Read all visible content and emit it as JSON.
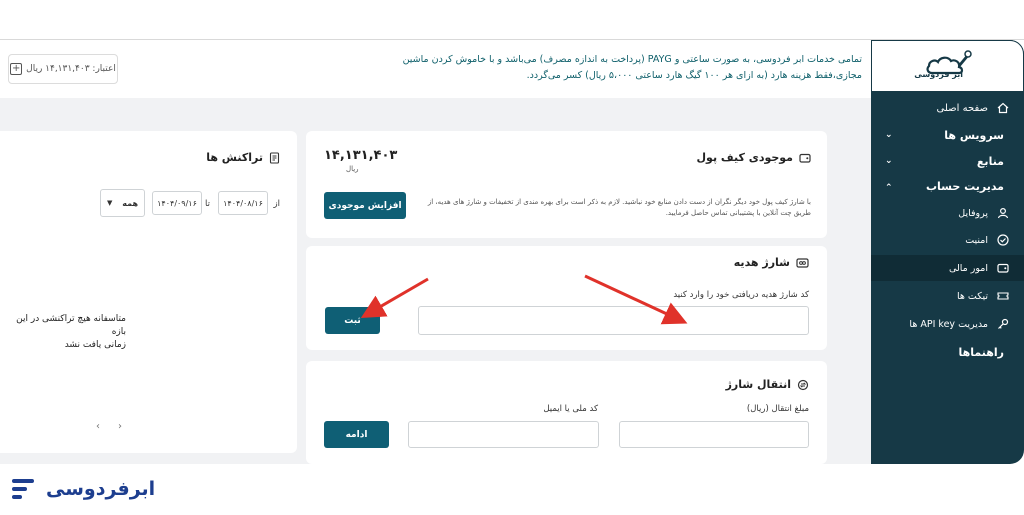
{
  "header": {
    "info_line1": "تمامی خدمات ابر فردوسی، به صورت ساعتی و PAYG (پرداخت به اندازه مصرف) می‌باشد و با خاموش کردن ماشین",
    "info_line2": "مجازی،فقط هزینه هارد (به ازای هر ۱۰۰ گیگ هارد ساعتی ۵،۰۰۰ ریال) کسر می‌گردد.",
    "balance_label": "اعتبار: ۱۴,۱۳۱,۴۰۳ ریال"
  },
  "sidebar": {
    "logo_text": "ابر فردوسی",
    "items": [
      {
        "label": "صفحه اصلی",
        "icon": "home-icon"
      },
      {
        "label": "سرویس ها",
        "icon": "chevron-down-icon"
      },
      {
        "label": "منابع",
        "icon": "chevron-down-icon"
      },
      {
        "label": "مدیریت حساب",
        "icon": "chevron-up-icon"
      },
      {
        "label": "پروفایل",
        "icon": "user-icon"
      },
      {
        "label": "امنیت",
        "icon": "shield-check-icon"
      },
      {
        "label": "امور مالی",
        "icon": "wallet-icon"
      },
      {
        "label": "تیکت ها",
        "icon": "ticket-icon"
      },
      {
        "label": "مدیریت API key ها",
        "icon": "key-icon"
      },
      {
        "label": "راهنماها",
        "icon": ""
      }
    ]
  },
  "wallet": {
    "title": "موجودی کیف پول",
    "amount": "۱۴,۱۳۱,۴۰۳",
    "currency": "ریال",
    "desc_line1": "با شارژ کیف پول خود دیگر نگران از دست دادن منابع خود نباشید. لازم به ذکر است برای بهره مندی از تخفیفات و شارژ های هدیه، از",
    "desc_line2": "طریق چت آنلاین با پشتیبانی تماس حاصل فرمایید.",
    "button": "افزایش موجودی"
  },
  "gift": {
    "title": "شارژ هدیه",
    "label": "کد شارژ هدیه دریافتی خود را وارد کنید",
    "input_value": "",
    "button": "ثبت"
  },
  "transfer": {
    "title": "انتقال شارژ",
    "amount_label": "مبلغ انتقال (ریال)",
    "target_label": "کد ملی یا ایمیل",
    "button": "ادامه"
  },
  "transactions": {
    "title": "تراکنش ها",
    "from_label": "از",
    "from_date": "۱۴۰۴/۰۸/۱۶",
    "to_label": "تا",
    "to_date": "۱۴۰۴/۰۹/۱۶",
    "filter": "همه",
    "empty_line1": "متاسفانه هیچ تراکنشی در این بازه",
    "empty_line2": "زمانی یافت نشد"
  },
  "footer": {
    "brand": "ابرفردوسی"
  },
  "colors": {
    "sidebar": "#163946",
    "primary_button": "#0f5f75",
    "info_text": "#0e5f6a",
    "arrow": "#e0322a",
    "brand_footer": "#1d3e8f"
  }
}
